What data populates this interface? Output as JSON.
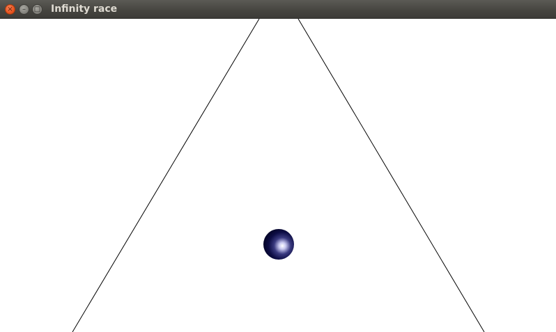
{
  "window": {
    "title": "Infinity race",
    "controls": {
      "close_glyph": "×",
      "minimize_glyph": "–",
      "maximize_glyph": "□"
    }
  },
  "scene": {
    "background": "#ffffff",
    "track_color": "#000000",
    "ball_color": "#0a0a3a",
    "ball_highlight": "#e8e8ff"
  }
}
